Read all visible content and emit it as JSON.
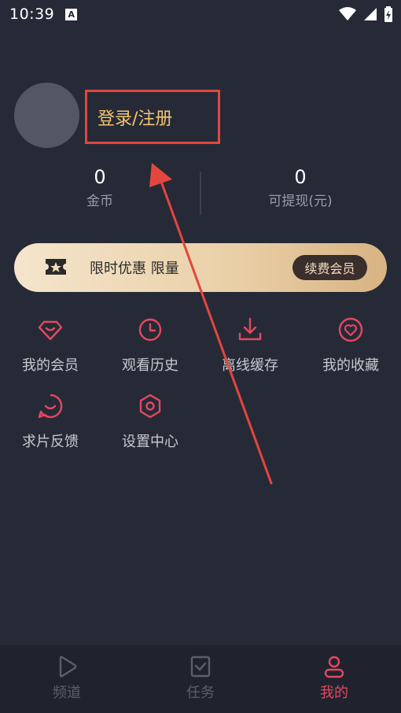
{
  "status_bar": {
    "time": "10:39",
    "left_icon": "A"
  },
  "profile": {
    "login_label": "登录/注册"
  },
  "stats": {
    "coins_value": "0",
    "coins_label": "金币",
    "cash_value": "0",
    "cash_label": "可提现(元)"
  },
  "vip_banner": {
    "text": "限时优惠 限量",
    "button_label": "续费会员"
  },
  "menu": {
    "items": [
      {
        "label": "我的会员",
        "icon": "diamond-icon"
      },
      {
        "label": "观看历史",
        "icon": "clock-icon"
      },
      {
        "label": "离线缓存",
        "icon": "download-icon"
      },
      {
        "label": "我的收藏",
        "icon": "heart-icon"
      },
      {
        "label": "求片反馈",
        "icon": "feedback-icon"
      },
      {
        "label": "设置中心",
        "icon": "settings-icon"
      }
    ]
  },
  "bottom_nav": {
    "tabs": [
      {
        "label": "频道",
        "icon": "play-icon",
        "active": false
      },
      {
        "label": "任务",
        "icon": "task-icon",
        "active": false
      },
      {
        "label": "我的",
        "icon": "user-icon",
        "active": true
      }
    ]
  },
  "colors": {
    "background": "#262a37",
    "accent": "#e4485f",
    "login_text": "#f4c56c",
    "annotation": "#e3463e"
  }
}
